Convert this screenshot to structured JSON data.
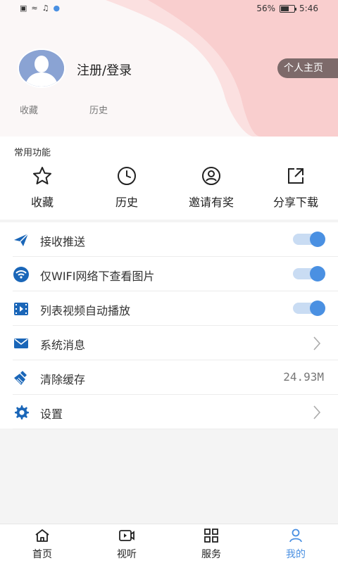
{
  "status_bar": {
    "battery": "56%",
    "time": "5:46"
  },
  "profile": {
    "login_text": "注册/登录",
    "homepage_button": "个人主页",
    "favorites_label": "收藏",
    "history_label": "历史"
  },
  "common_functions": {
    "title": "常用功能",
    "items": [
      {
        "label": "收藏",
        "icon": "star-icon"
      },
      {
        "label": "历史",
        "icon": "clock-icon"
      },
      {
        "label": "邀请有奖",
        "icon": "user-circle-icon"
      },
      {
        "label": "分享下载",
        "icon": "share-icon"
      }
    ]
  },
  "settings": {
    "items": [
      {
        "label": "接收推送",
        "icon": "paper-plane-icon",
        "control": "toggle",
        "on": true
      },
      {
        "label": "仅WIFI网络下查看图片",
        "icon": "wifi-icon",
        "control": "toggle",
        "on": true
      },
      {
        "label": "列表视频自动播放",
        "icon": "film-icon",
        "control": "toggle",
        "on": true
      },
      {
        "label": "系统消息",
        "icon": "envelope-icon",
        "control": "chevron"
      },
      {
        "label": "清除缓存",
        "icon": "broom-icon",
        "control": "value",
        "value": "24.93M"
      },
      {
        "label": "设置",
        "icon": "gear-icon",
        "control": "chevron"
      }
    ]
  },
  "bottom_nav": {
    "tabs": [
      {
        "label": "首页",
        "icon": "home-icon",
        "active": false
      },
      {
        "label": "视听",
        "icon": "video-icon",
        "active": false
      },
      {
        "label": "服务",
        "icon": "grid-icon",
        "active": false
      },
      {
        "label": "我的",
        "icon": "person-icon",
        "active": true
      }
    ]
  },
  "colors": {
    "accent": "#4a90e2",
    "icon_blue": "#1a66b8",
    "toggle_track": "#c9dcf3",
    "header_pink": "#f9cfcf",
    "homepage_button_bg": "#7d6a6a"
  }
}
